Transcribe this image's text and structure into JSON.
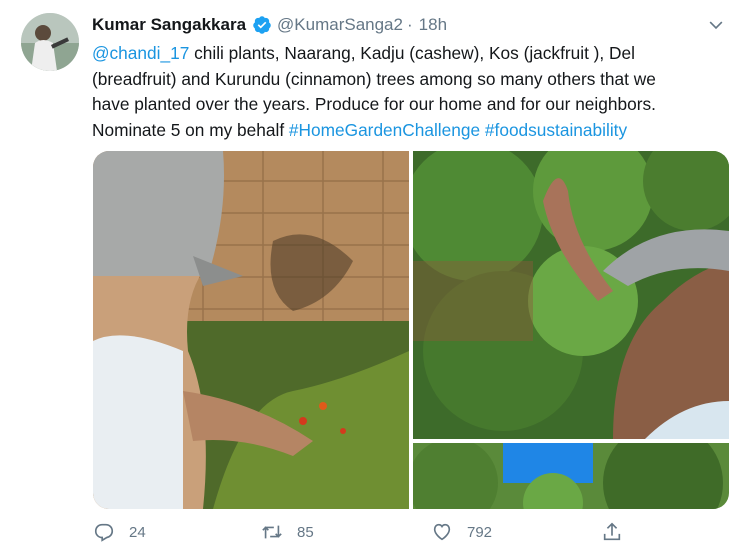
{
  "tweet": {
    "author_name": "Kumar Sangakkara",
    "handle": "@KumarSanga2",
    "separator": "·",
    "time": "18h",
    "verified": true,
    "mention": "@chandi_17",
    "body": " chili plants, Naarang, Kadju (cashew), Kos (jackfruit ), Del\n(breadfruit) and Kurundu (cinnamon) trees among so many others that we\nhave planted over the years. Produce for our home and for our neighbors.\nNominate 5 on my behalf ",
    "hashtag_1": "#HomeGardenChallenge",
    "hashtag_space": " ",
    "hashtag_2": "#foodsustainability"
  },
  "actions": {
    "replies": "24",
    "retweets": "85",
    "likes": "792"
  },
  "icons": {
    "verified": "verified-badge-icon",
    "more": "chevron-down-icon",
    "reply": "reply-icon",
    "retweet": "retweet-icon",
    "like": "heart-icon",
    "share": "share-icon"
  },
  "colors": {
    "link": "#1b95e0",
    "muted": "#657786",
    "text": "#14171a",
    "verified": "#1da1f2"
  }
}
